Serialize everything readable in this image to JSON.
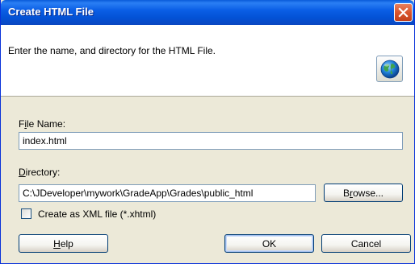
{
  "window": {
    "title": "Create HTML File",
    "description": "Enter the name, and directory for the HTML File."
  },
  "form": {
    "file_name_label_prefix": "F",
    "file_name_label_mnemonic": "i",
    "file_name_label_suffix": "le Name:",
    "file_name_value": "index.html",
    "directory_label_mnemonic": "D",
    "directory_label_suffix": "irectory:",
    "directory_value": "C:\\JDeveloper\\mywork\\GradeApp\\Grades\\public_html",
    "browse_label_prefix": "B",
    "browse_label_mnemonic": "r",
    "browse_label_suffix": "owse...",
    "xml_checkbox_label": "Create as XML file (*.xhtml)",
    "xml_checkbox_checked": false
  },
  "buttons": {
    "help_mnemonic": "H",
    "help_suffix": "elp",
    "ok_label": "OK",
    "cancel_label": "Cancel"
  },
  "icons": {
    "header_icon": "globe-icon",
    "close_icon": "close-icon"
  },
  "colors": {
    "titlebar": "#0352d6",
    "close_button": "#d9552d",
    "dialog_background": "#ece9d8"
  }
}
